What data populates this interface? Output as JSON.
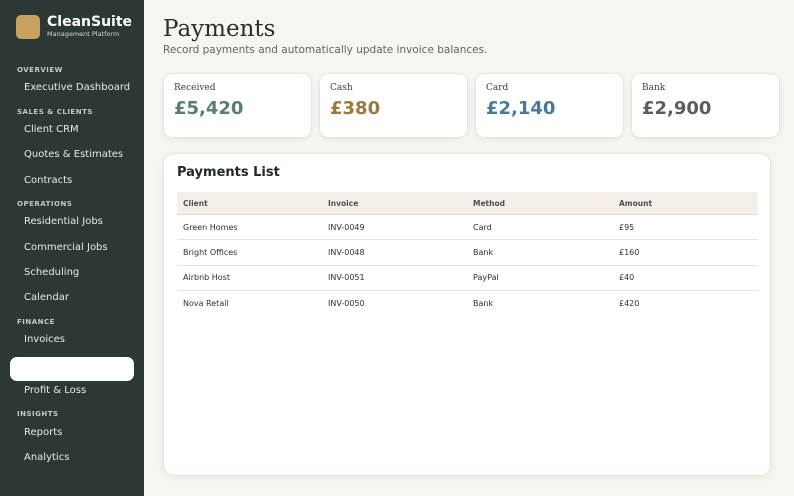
{
  "brand": {
    "name": "CleanSuite",
    "subtitle": "Management Platform"
  },
  "sidebar": {
    "sections": [
      {
        "title": "OVERVIEW",
        "items": [
          "Executive Dashboard"
        ]
      },
      {
        "title": "SALES & CLIENTS",
        "items": [
          "Client CRM",
          "Quotes & Estimates",
          "Contracts"
        ]
      },
      {
        "title": "OPERATIONS",
        "items": [
          "Residential Jobs",
          "Commercial Jobs",
          "Scheduling",
          "Calendar"
        ]
      },
      {
        "title": "FINANCE",
        "items": [
          "Invoices",
          "",
          "Profit & Loss"
        ]
      },
      {
        "title": "INSIGHTS",
        "items": [
          "Reports",
          "Analytics"
        ]
      }
    ]
  },
  "page": {
    "title": "Payments",
    "subtitle": "Record payments and automatically update invoice balances."
  },
  "stats": [
    {
      "label": "Received",
      "value": "£5,420",
      "color": "#5b7d6c"
    },
    {
      "label": "Cash",
      "value": "£380",
      "color": "#9a7a3c"
    },
    {
      "label": "Card",
      "value": "£2,140",
      "color": "#4a7a9b"
    },
    {
      "label": "Bank",
      "value": "£2,900",
      "color": "#5a5f5d"
    }
  ],
  "payments": {
    "title": "Payments List",
    "columns": [
      "Client",
      "Invoice",
      "Method",
      "Amount"
    ],
    "rows": [
      [
        "Green Homes",
        "INV-0049",
        "Card",
        "£95"
      ],
      [
        "Bright Offices",
        "INV-0048",
        "Bank",
        "£160"
      ],
      [
        "Airbnb Host",
        "INV-0051",
        "PayPal",
        "£40"
      ],
      [
        "Nova Retail",
        "INV-0050",
        "Bank",
        "£420"
      ]
    ]
  }
}
